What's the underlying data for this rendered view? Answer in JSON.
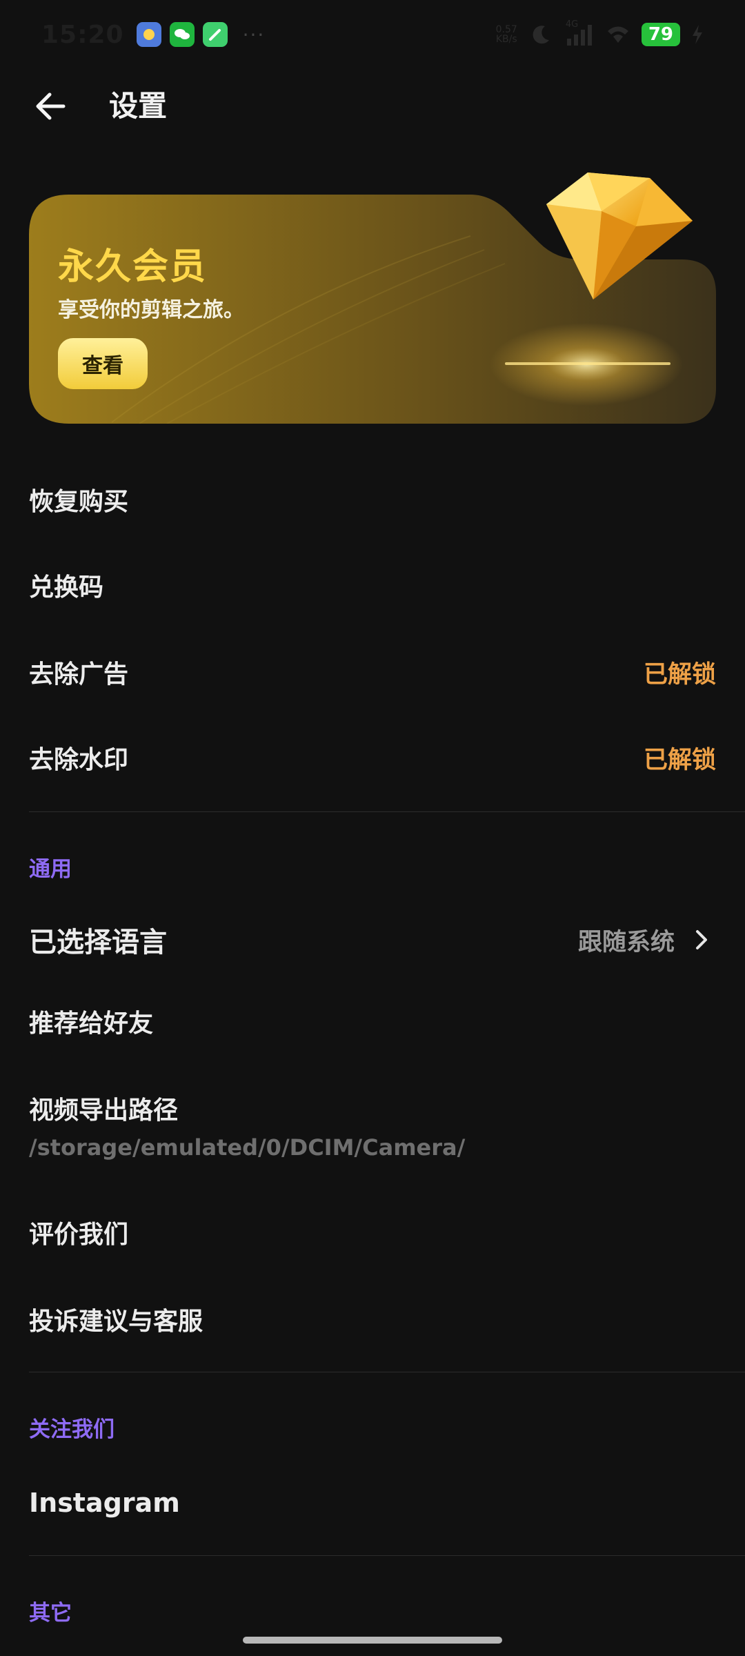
{
  "status_bar": {
    "time": "15:20",
    "more": "···",
    "net_speed_value": "0.57",
    "net_speed_unit": "KB/s",
    "network_type": "4G",
    "battery": "79"
  },
  "header": {
    "title": "设置"
  },
  "banner": {
    "title": "永久会员",
    "subtitle": "享受你的剪辑之旅。",
    "view_button": "查看"
  },
  "purchase_items": [
    {
      "label": "恢复购买"
    },
    {
      "label": "兑换码"
    },
    {
      "label": "去除广告",
      "value": "已解锁"
    },
    {
      "label": "去除水印",
      "value": "已解锁"
    }
  ],
  "general": {
    "section_title": "通用",
    "language_label": "已选择语言",
    "language_value": "跟随系统",
    "recommend": "推荐给好友",
    "export_path_label": "视频导出路径",
    "export_path_value": "/storage/emulated/0/DCIM/Camera/",
    "rate": "评价我们",
    "feedback": "投诉建议与客服"
  },
  "follow": {
    "section_title": "关注我们",
    "instagram": "Instagram"
  },
  "other": {
    "section_title": "其它"
  },
  "colors": {
    "background": "#111111",
    "accent_purple": "#8e6bf4",
    "unlocked_orange": "#eea147",
    "gold": "#ffd84a"
  }
}
